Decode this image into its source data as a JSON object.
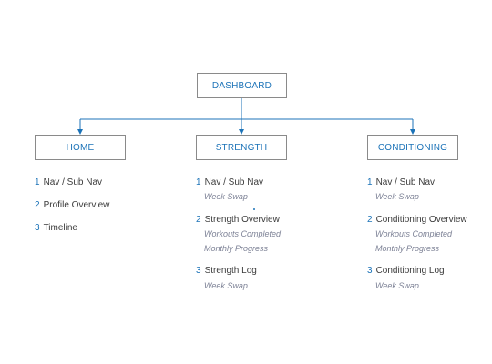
{
  "colors": {
    "accent": "#1c73b8",
    "border": "#8a8a8a",
    "text": "#3a3a3a",
    "subtext": "#7d8296"
  },
  "root": {
    "label": "DASHBOARD"
  },
  "columns": [
    {
      "label": "HOME",
      "items": [
        {
          "num": "1",
          "label": "Nav / Sub Nav",
          "subs": []
        },
        {
          "num": "2",
          "label": "Profile Overview",
          "subs": []
        },
        {
          "num": "3",
          "label": "Timeline",
          "subs": []
        }
      ]
    },
    {
      "label": "STRENGTH",
      "items": [
        {
          "num": "1",
          "label": "Nav / Sub Nav",
          "subs": [
            "Week Swap"
          ]
        },
        {
          "num": "2",
          "label": "Strength Overview",
          "subs": [
            "Workouts Completed",
            "Monthly Progress"
          ]
        },
        {
          "num": "3",
          "label": "Strength Log",
          "subs": [
            "Week Swap"
          ]
        }
      ]
    },
    {
      "label": "CONDITIONING",
      "items": [
        {
          "num": "1",
          "label": "Nav / Sub Nav",
          "subs": [
            "Week Swap"
          ]
        },
        {
          "num": "2",
          "label": "Conditioning Overview",
          "subs": [
            "Workouts Completed",
            "Monthly Progress"
          ]
        },
        {
          "num": "3",
          "label": "Conditioning Log",
          "subs": [
            "Week Swap"
          ]
        }
      ]
    }
  ]
}
